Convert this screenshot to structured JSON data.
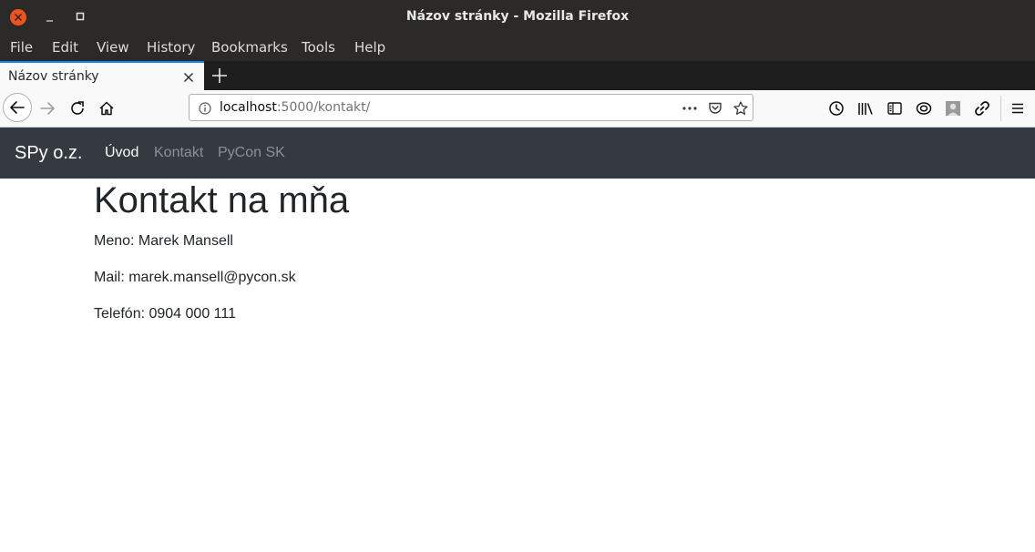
{
  "window": {
    "title": "Názov stránky - Mozilla Firefox"
  },
  "menu": {
    "items": [
      "File",
      "Edit",
      "View",
      "History",
      "Bookmarks",
      "Tools",
      "Help"
    ]
  },
  "tabs": [
    {
      "title": "Názov stránky",
      "active": true
    }
  ],
  "urlbar": {
    "host": "localhost",
    "rest": ":5000/kontakt/"
  },
  "icons": {
    "toolbar": [
      "back-icon",
      "forward-icon",
      "reload-icon",
      "home-icon",
      "info-icon",
      "page-actions-icon",
      "pocket-icon",
      "bookmark-star-icon",
      "history-icon",
      "library-icon",
      "sidebar-icon",
      "sync-icon",
      "account-icon",
      "link-icon",
      "hamburger-menu-icon"
    ]
  },
  "colors": {
    "accent": "#0a84ff",
    "ubuntu_close": "#e95420",
    "site_navbar": "#343a40"
  },
  "site": {
    "brand": "SPy o.z.",
    "nav": [
      {
        "label": "Úvod",
        "active": true
      },
      {
        "label": "Kontakt",
        "active": false
      },
      {
        "label": "PyCon SK",
        "active": false
      }
    ]
  },
  "contact": {
    "heading": "Kontakt na mňa",
    "name_line": "Meno: Marek Mansell",
    "mail_line": "Mail: marek.mansell@pycon.sk",
    "phone_line": "Telefón: 0904 000 111"
  }
}
